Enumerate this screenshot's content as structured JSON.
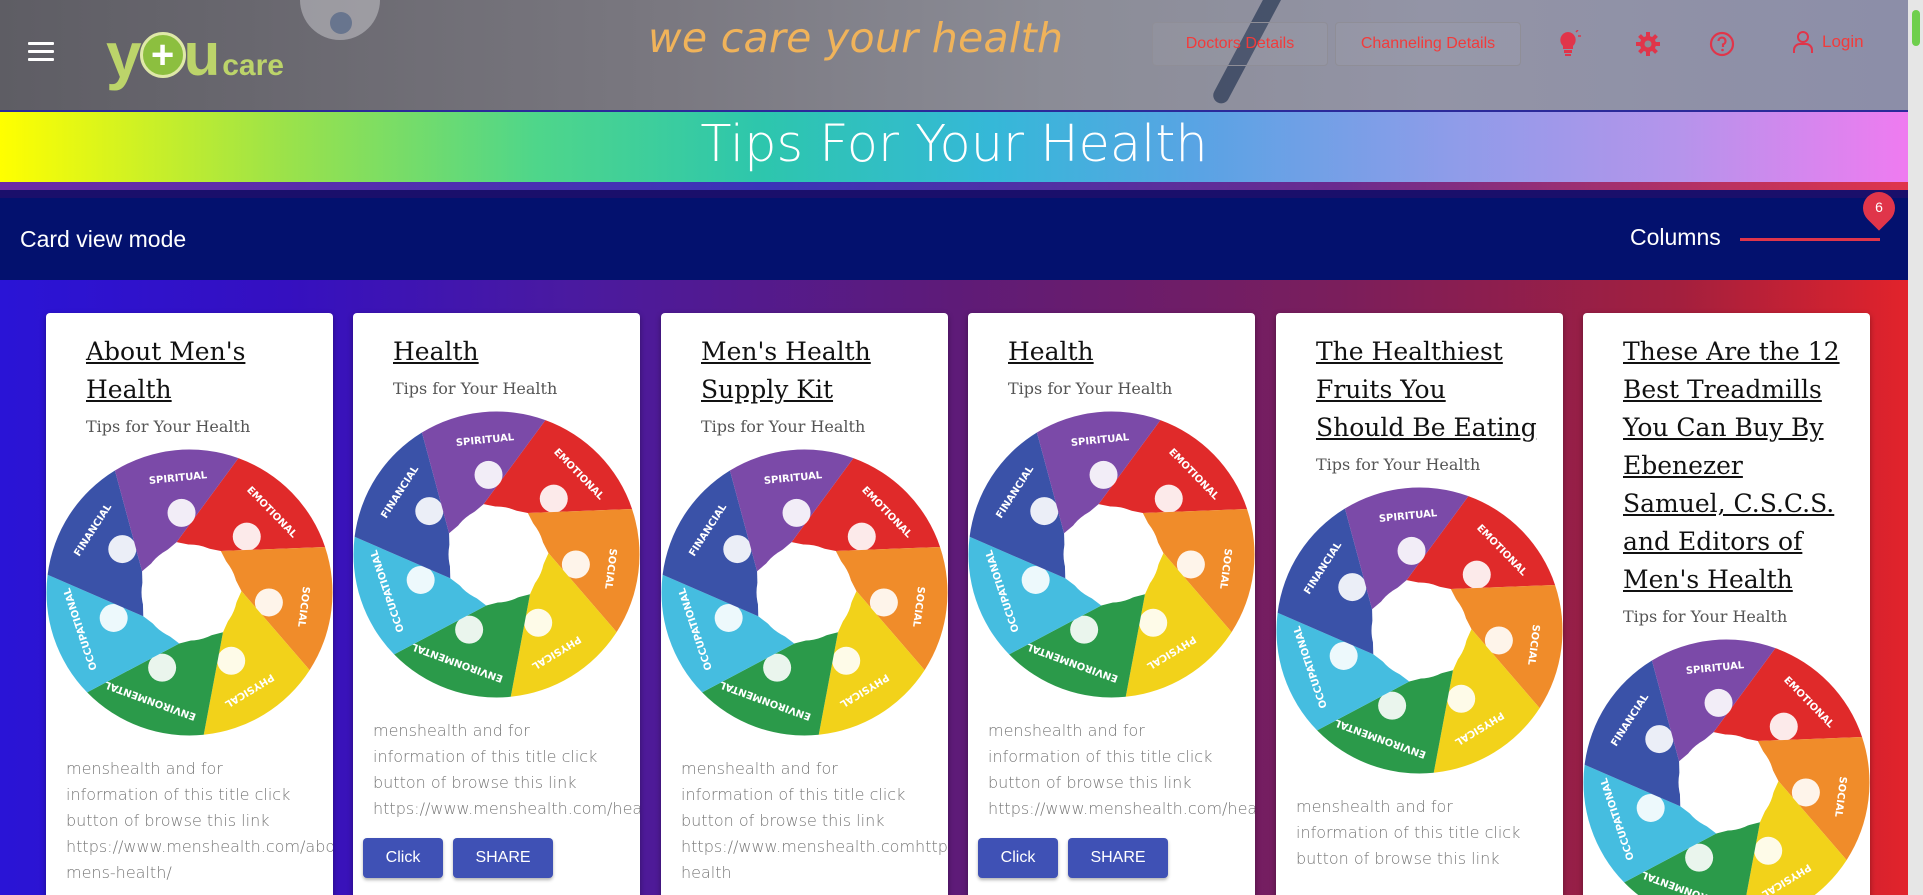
{
  "header": {
    "tagline": "we care your health",
    "logo": {
      "y": "y",
      "plus": "+",
      "u": "u",
      "care": "care"
    },
    "buttons": {
      "doctors": "Doctors Details",
      "channeling": "Channeling Details"
    },
    "icons": [
      "menu-icon",
      "lightbulb-icon",
      "gear-icon",
      "help-icon",
      "user-icon"
    ],
    "login": "Login"
  },
  "banner": {
    "title": "Tips For Your Health"
  },
  "toolbar": {
    "mode": "Card view mode",
    "columns_label": "Columns",
    "columns_value": "6"
  },
  "colors": {
    "accent_red": "#e0354a",
    "toolbar_bg": "#03116e",
    "button": "#3f51b5",
    "tagline": "#f0b35a",
    "header_btn_text": "#f23b3b"
  },
  "wheel_labels": [
    "EMOTIONAL",
    "SOCIAL",
    "PHYSICAL",
    "ENVIRONMENTAL",
    "OCCUPATIONAL",
    "FINANCIAL",
    "SPIRITUAL"
  ],
  "cards": [
    {
      "title_lines": [
        "About Men's",
        "Health"
      ],
      "subtitle": "Tips for Your Health",
      "desc_lines": [
        "menshealth and for",
        "information of this title click",
        "button of browse this link",
        "https://www.menshealth.com/about-",
        "mens-health/"
      ]
    },
    {
      "title_lines": [
        "Health"
      ],
      "subtitle": "Tips for Your Health",
      "desc_lines": [
        "menshealth and for",
        "information of this title click",
        "button of browse this link",
        "https://www.menshealth.com/health/"
      ],
      "buttons": [
        "Click",
        "SHARE"
      ]
    },
    {
      "title_lines": [
        "Men's Health",
        "Supply Kit"
      ],
      "subtitle": "Tips for Your Health",
      "desc_lines": [
        "menshealth and for",
        "information of this title click",
        "button of browse this link",
        "https://www.menshealth.comhttps://",
        "health"
      ]
    },
    {
      "title_lines": [
        "Health"
      ],
      "subtitle": "Tips for Your Health",
      "desc_lines": [
        "menshealth and for",
        "information of this title click",
        "button of browse this link",
        "https://www.menshealth.com/health/"
      ],
      "buttons": [
        "Click",
        "SHARE"
      ]
    },
    {
      "title_lines": [
        "The Healthiest",
        "Fruits You",
        "Should Be Eating"
      ],
      "subtitle": "Tips for Your Health",
      "desc_lines": [
        "menshealth and for",
        "information of this title click",
        "button of browse this link"
      ]
    },
    {
      "title_lines": [
        "These Are the 12",
        "Best Treadmills",
        "You Can Buy By",
        "Ebenezer",
        "Samuel, C.S.C.S.",
        "and Editors of",
        "Men's Health"
      ],
      "subtitle": "Tips for Your Health",
      "desc_lines": []
    }
  ]
}
